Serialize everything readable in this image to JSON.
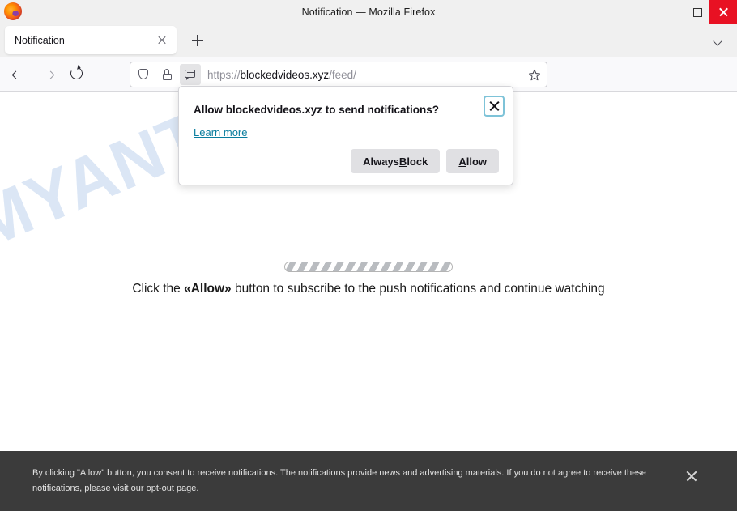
{
  "window": {
    "title": "Notification — Mozilla Firefox",
    "logo_icon": "firefox-logo",
    "minimize_label": "Minimize",
    "maximize_label": "Maximize",
    "close_label": "Close"
  },
  "tabs": {
    "items": [
      {
        "label": "Notification",
        "close_icon": "close-icon"
      }
    ],
    "new_tab_icon": "plus-icon",
    "list_all_tabs_icon": "chevron-down-icon"
  },
  "toolbar": {
    "back_icon": "arrow-left-icon",
    "forward_icon": "arrow-right-icon",
    "reload_icon": "reload-icon",
    "shield_icon": "shield-icon",
    "lock_icon": "lock-icon",
    "permission_icon": "notification-bubble-icon",
    "bookmark_icon": "star-icon",
    "pocket_icon": "pocket-icon",
    "downloads_icon": "download-icon",
    "overflow_icon": "double-chevron-icon",
    "extensions_icon": "puzzle-icon",
    "menu_icon": "hamburger-menu-icon"
  },
  "url": {
    "scheme": "https://",
    "host": "blockedvideos.xyz",
    "path": "/feed/",
    "full": "https://blockedvideos.xyz/feed/"
  },
  "permission_popup": {
    "title": "Allow blockedvideos.xyz to send notifications?",
    "learn_more": "Learn more",
    "always_block_prefix": "Always ",
    "always_block_key": "B",
    "always_block_suffix": "lock",
    "allow_key": "A",
    "allow_suffix": "llow",
    "close_icon": "close-icon"
  },
  "page": {
    "watermark": "MYANTISPYWARE.COM",
    "watermark_color": "#dbe6f5",
    "loader_icon": "striped-progress-bar",
    "message_prefix": "Click the ",
    "message_bold": "«Allow»",
    "message_suffix": " button to subscribe to the push notifications and continue watching"
  },
  "consent_bar": {
    "text_part1": "By clicking \"Allow\" button, you consent to receive notifications. The notifications provide news and advertising materials. If you do not agree to receive these notifications, please visit our ",
    "link_text": "opt-out page",
    "text_part2": ".",
    "close_icon": "close-icon",
    "background": "#3b3b3b"
  }
}
